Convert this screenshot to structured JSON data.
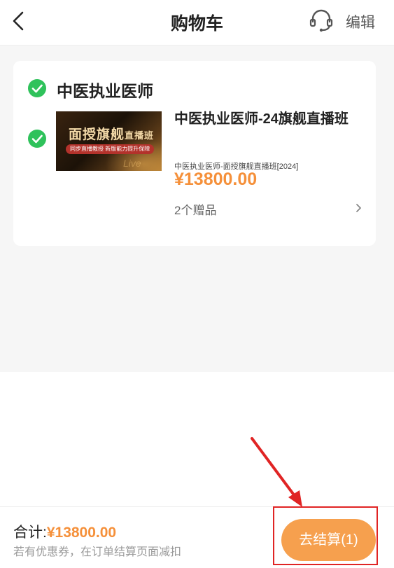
{
  "header": {
    "title": "购物车",
    "edit_label": "编辑"
  },
  "cart": {
    "shop_name": "中医执业医师",
    "items": [
      {
        "title": "中医执业医师-24旗舰直播班",
        "subtitle": "中医执业医师-面授旗舰直播班[2024]",
        "price": "¥13800.00",
        "gift_label": "2个赠品",
        "thumbnail": {
          "title_main": "面授旗舰",
          "title_small": "直播班",
          "tagline": "同步直播教授 新版能力提升保障",
          "deco_text": "Live"
        },
        "selected": true
      }
    ]
  },
  "footer": {
    "total_prefix": "合计:",
    "total_amount": "¥13800.00",
    "coupon_note": "若有优惠券，在订单结算页面减扣",
    "checkout_label": "去结算(1)"
  },
  "colors": {
    "accent_orange": "#f5903a",
    "checkout_button": "#f6a04e",
    "check_green": "#2fc25b",
    "annotation_red": "#e02424"
  },
  "icons": {
    "back": "chevron-left-icon",
    "service": "headset-icon",
    "check": "checkmark-circle-icon",
    "gift_chevron": "chevron-right-icon"
  }
}
